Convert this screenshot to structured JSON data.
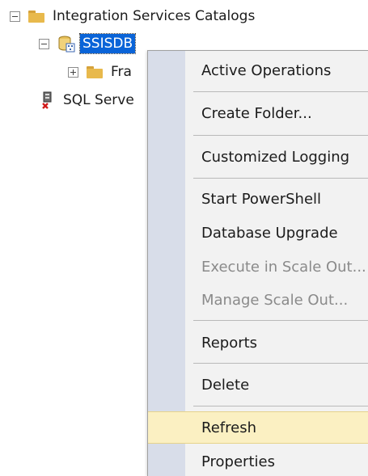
{
  "tree": {
    "catalogs_label": "Integration Services Catalogs",
    "ssisdb_label": "SSISDB",
    "folder_label": "Fra",
    "server_label": "SQL Serve"
  },
  "menu": {
    "active_operations": "Active Operations",
    "create_folder": "Create Folder...",
    "customized_logging": "Customized Logging",
    "start_powershell": "Start PowerShell",
    "database_upgrade": "Database Upgrade",
    "execute_scale_out": "Execute in Scale Out...",
    "manage_scale_out": "Manage Scale Out...",
    "reports": "Reports",
    "delete": "Delete",
    "refresh": "Refresh",
    "properties": "Properties"
  },
  "colors": {
    "selection": "#0a64d8",
    "menu_background": "#f2f2f2",
    "menu_gutter": "#d8dde9",
    "hover_highlight": "#fbf0c2",
    "folder": "#e8b94c"
  }
}
